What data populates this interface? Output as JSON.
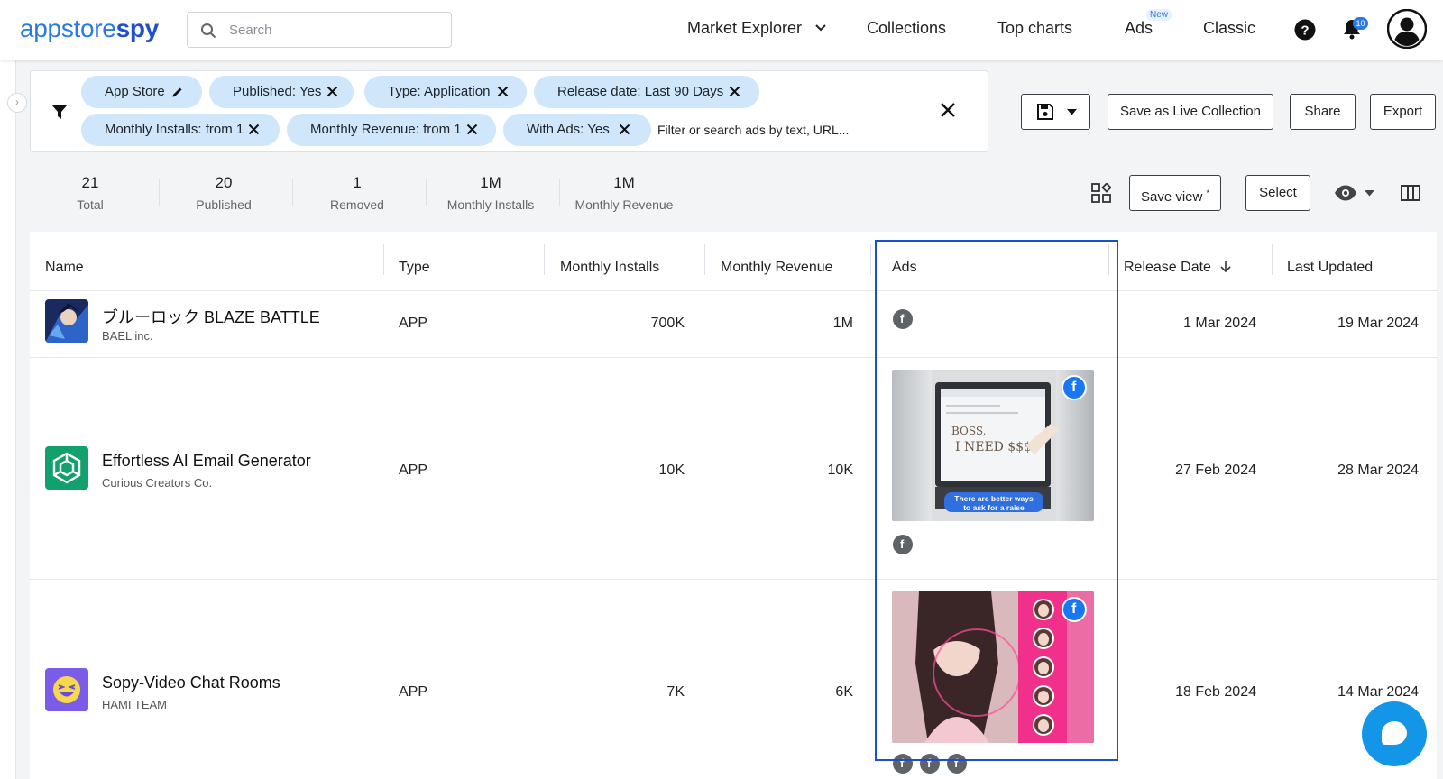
{
  "header": {
    "logo_part1": "appstore",
    "logo_part2": "spy",
    "search_placeholder": "Search",
    "nav": {
      "market_explorer": "Market Explorer",
      "collections": "Collections",
      "top_charts": "Top charts",
      "ads": "Ads",
      "ads_badge": "New",
      "classic": "Classic"
    },
    "notification_count": "10"
  },
  "filters": {
    "chips": [
      {
        "label": "App Store"
      },
      {
        "label": "Published: Yes"
      },
      {
        "label": "Type: Application"
      },
      {
        "label": "Release date: Last 90 Days"
      },
      {
        "label": "Monthly Installs: from 1"
      },
      {
        "label": "Monthly Revenue: from 1"
      },
      {
        "label": "With Ads: Yes"
      }
    ],
    "search_placeholder": "Filter or search ads by text, URL..."
  },
  "actions": {
    "save_live": "Save as Live Collection",
    "share": "Share",
    "export": "Export",
    "save_view": "Save view",
    "save_view_mark": "*",
    "select": "Select"
  },
  "stats": [
    {
      "value": "21",
      "label": "Total"
    },
    {
      "value": "20",
      "label": "Published"
    },
    {
      "value": "1",
      "label": "Removed"
    },
    {
      "value": "1M",
      "label": "Monthly Installs"
    },
    {
      "value": "1M",
      "label": "Monthly Revenue"
    }
  ],
  "table": {
    "columns": [
      "Name",
      "Type",
      "Monthly Installs",
      "Monthly Revenue",
      "Ads",
      "Release Date",
      "Last Updated"
    ],
    "rows": [
      {
        "name": "ブルーロック BLAZE BATTLE",
        "developer": "BAEL inc.",
        "type": "APP",
        "installs": "700K",
        "revenue": "1M",
        "release": "1 Mar 2024",
        "updated": "19 Mar 2024"
      },
      {
        "name": "Effortless AI Email Generator",
        "developer": "Curious Creators Co.",
        "type": "APP",
        "installs": "10K",
        "revenue": "10K",
        "release": "27 Feb 2024",
        "updated": "28 Mar 2024",
        "ad_caption": "There are better ways to ask for a raise",
        "ad_screen_text_1": "BOSS,",
        "ad_screen_text_2": "I NEED $$$"
      },
      {
        "name": "Sopy-Video Chat Rooms",
        "developer": "HAMI TEAM",
        "type": "APP",
        "installs": "7K",
        "revenue": "6K",
        "release": "18 Feb 2024",
        "updated": "14 Mar 2024"
      }
    ]
  },
  "icons": {
    "facebook": "f"
  },
  "colors": {
    "accent": "#2a7ae2",
    "chip_bg": "#cfe6fb",
    "highlight": "#1a4fd1",
    "facebook": "#1877f2"
  }
}
